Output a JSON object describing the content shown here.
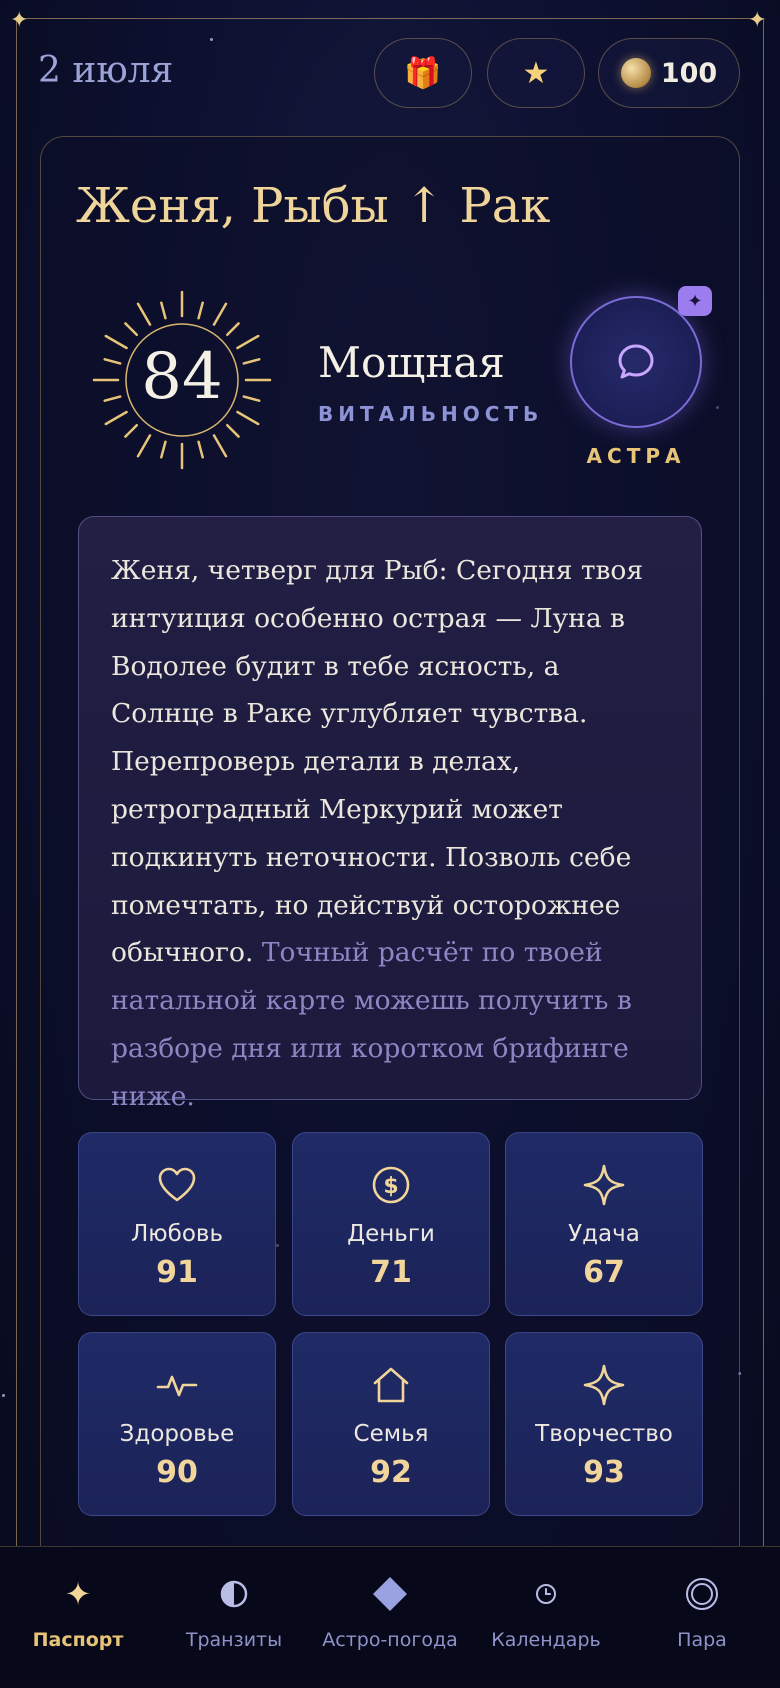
{
  "header": {
    "date": "2 июля",
    "coins": "100"
  },
  "profile": {
    "title": "Женя, Рыбы ↑ Рак",
    "score": "84",
    "level": "Мощная",
    "metric": "ВИТАЛЬНОСТЬ",
    "assistant_label": "АСТРА"
  },
  "forecast": {
    "main": "Женя, четверг для Рыб: Сегодня твоя интуиция особенно острая — Луна в Водолее будит в тебе ясность, а Солнце в Раке углубляет чувства. Перепроверь детали в делах, ретроградный Меркурий может подкинуть неточности. Позволь себе помечтать, но действуй осторожнее обычного.",
    "hint": "Точный расчёт по твоей натальной карте можешь получить в разборе дня или коротком брифинге ниже."
  },
  "stats": [
    {
      "label": "Любовь",
      "value": "91",
      "icon": "heart-icon"
    },
    {
      "label": "Деньги",
      "value": "71",
      "icon": "dollar-coin-icon"
    },
    {
      "label": "Удача",
      "value": "67",
      "icon": "sparkle-icon"
    },
    {
      "label": "Здоровье",
      "value": "90",
      "icon": "pulse-icon"
    },
    {
      "label": "Семья",
      "value": "92",
      "icon": "house-icon"
    },
    {
      "label": "Творчество",
      "value": "93",
      "icon": "sparkle-icon"
    }
  ],
  "nav": [
    {
      "label": "Паспорт",
      "icon": "sparkle-icon",
      "active": true
    },
    {
      "label": "Транзиты",
      "icon": "half-moon-icon"
    },
    {
      "label": "Астро-погода",
      "icon": "diamond-icon"
    },
    {
      "label": "Календарь",
      "icon": "clock-icon"
    },
    {
      "label": "Пара",
      "icon": "rings-icon"
    }
  ],
  "colors": {
    "accent_gold": "#e8c478",
    "accent_purple": "#9c7df0",
    "background": "#0b0d24"
  }
}
